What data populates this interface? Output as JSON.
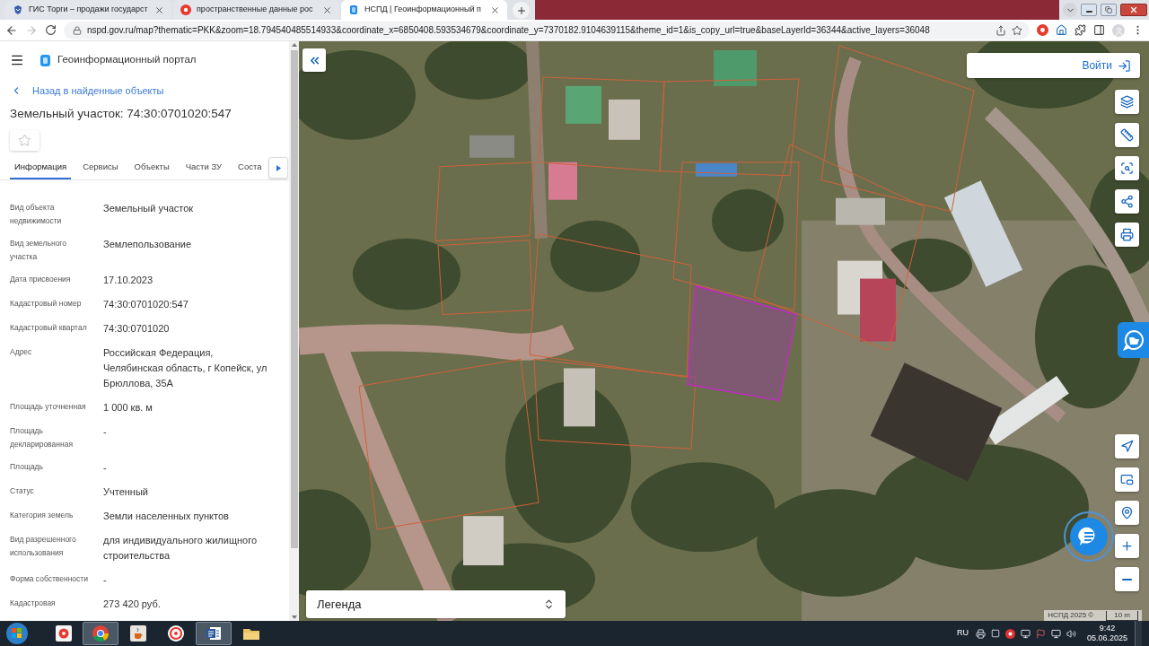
{
  "browser": {
    "tabs": [
      {
        "title": "ГИС Торги – продажи государст",
        "selected": false
      },
      {
        "title": "пространственные данные рос",
        "selected": false
      },
      {
        "title": "НСПД | Геоинформационный п",
        "selected": true
      }
    ],
    "url": "nspd.gov.ru/map?thematic=PKK&zoom=18.794540485514933&coordinate_x=6850408.593534679&coordinate_y=7370182.9104639115&theme_id=1&is_copy_url=true&baseLayerId=36344&active_layers=36048"
  },
  "header": {
    "title": "Геоинформационный портал"
  },
  "back_link": "Назад в найденные объекты",
  "object_title": "Земельный участок: 74:30:0701020:547",
  "favorited": false,
  "tabs": [
    {
      "label": "Информация",
      "selected": true
    },
    {
      "label": "Сервисы",
      "selected": false
    },
    {
      "label": "Объекты",
      "selected": false
    },
    {
      "label": "Части ЗУ",
      "selected": false
    },
    {
      "label": "Соста",
      "selected": false
    }
  ],
  "properties": [
    {
      "label": "Вид объекта недвижимости",
      "value": "Земельный участок"
    },
    {
      "label": "Вид земельного участка",
      "value": "Землепользование"
    },
    {
      "label": "Дата присвоения",
      "value": "17.10.2023"
    },
    {
      "label": "Кадастровый номер",
      "value": "74:30:0701020:547"
    },
    {
      "label": "Кадастровый квартал",
      "value": "74:30:0701020"
    },
    {
      "label": "Адрес",
      "value": "Российская Федерация, Челябинская область, г Копейск, ул Брюллова, 35А"
    },
    {
      "label": "Площадь уточненная",
      "value": "1 000 кв. м"
    },
    {
      "label": "Площадь декларированная",
      "value": "-"
    },
    {
      "label": "Площадь",
      "value": "-"
    },
    {
      "label": "Статус",
      "value": "Учтенный"
    },
    {
      "label": "Категория земель",
      "value": "Земли населенных пунктов"
    },
    {
      "label": "Вид разрешенного использования",
      "value": "для индивидуального жилищного строительства"
    },
    {
      "label": "Форма собственности",
      "value": "-"
    },
    {
      "label": "Кадастровая",
      "value": "273 420 руб."
    }
  ],
  "map": {
    "login_button": "Войти",
    "legend": "Легенда",
    "attribution": "НСПД 2025 ©",
    "scale": "10 m"
  },
  "taskbar": {
    "language": "RU",
    "time": "9:42",
    "date": "05.06.2025"
  }
}
